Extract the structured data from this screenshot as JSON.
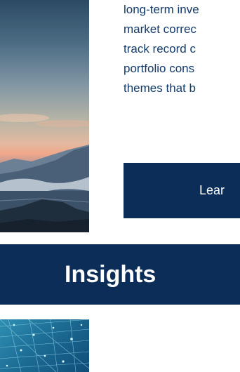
{
  "about": {
    "paragraph_lines": [
      "long-term inve",
      "market correc",
      "track record c",
      "portfolio cons",
      "themes that b"
    ],
    "button_label": "Lear"
  },
  "insights": {
    "title": "Insights"
  },
  "colors": {
    "brand_navy": "#0b2d58",
    "body_text": "#123a6b",
    "background": "#ffffff"
  }
}
